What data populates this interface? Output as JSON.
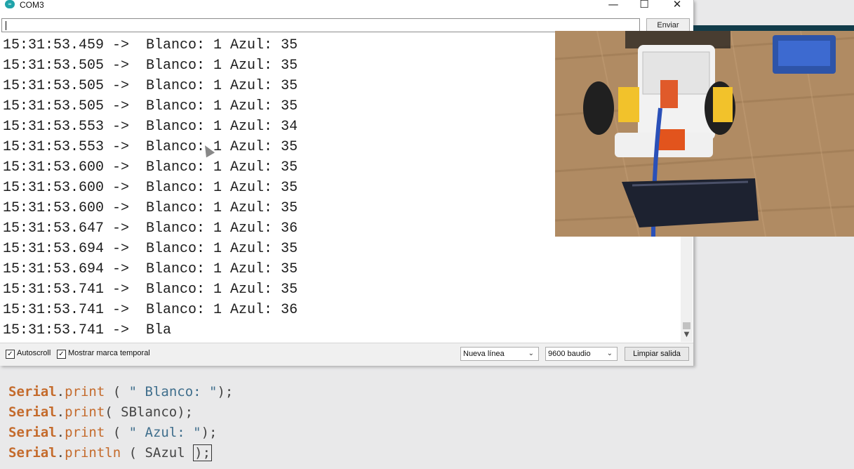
{
  "window": {
    "title": "COM3",
    "minimize_glyph": "—",
    "maximize_glyph": "☐",
    "close_glyph": "✕"
  },
  "send_bar": {
    "input_value": "",
    "send_label": "Enviar"
  },
  "output_lines": [
    "15:31:53.459 ->  Blanco: 1 Azul: 35",
    "15:31:53.505 ->  Blanco: 1 Azul: 35",
    "15:31:53.505 ->  Blanco: 1 Azul: 35",
    "15:31:53.505 ->  Blanco: 1 Azul: 35",
    "15:31:53.553 ->  Blanco: 1 Azul: 34",
    "15:31:53.553 ->  Blanco: 1 Azul: 35",
    "15:31:53.600 ->  Blanco: 1 Azul: 35",
    "15:31:53.600 ->  Blanco: 1 Azul: 35",
    "15:31:53.600 ->  Blanco: 1 Azul: 35",
    "15:31:53.647 ->  Blanco: 1 Azul: 36",
    "15:31:53.694 ->  Blanco: 1 Azul: 35",
    "15:31:53.694 ->  Blanco: 1 Azul: 35",
    "15:31:53.741 ->  Blanco: 1 Azul: 35",
    "15:31:53.741 ->  Blanco: 1 Azul: 36",
    "15:31:53.741 ->  Bla"
  ],
  "status_bar": {
    "autoscroll_label": "Autoscroll",
    "autoscroll_checked": true,
    "timestamp_label": "Mostrar marca temporal",
    "timestamp_checked": true,
    "line_ending_value": "Nueva línea",
    "baud_value": "9600 baudio",
    "clear_label": "Limpiar salida"
  },
  "code_snippet": [
    {
      "cls": "Serial",
      "fn": "print",
      "rest": " ( ",
      "str": "\" Blanco: \"",
      "tail": ");"
    },
    {
      "cls": "Serial",
      "fn": "print",
      "rest": "( SBlanco);",
      "str": "",
      "tail": ""
    },
    {
      "cls": "Serial",
      "fn": "print",
      "rest": " ( ",
      "str": "\" Azul: \"",
      "tail": ");"
    },
    {
      "cls": "Serial",
      "fn": "println",
      "rest": " ( SAzul ",
      "str": "",
      "tail": ");"
    }
  ],
  "colors": {
    "keyword": "#c46a2b",
    "string": "#3f6e8c",
    "accent": "#1fa3a9"
  }
}
